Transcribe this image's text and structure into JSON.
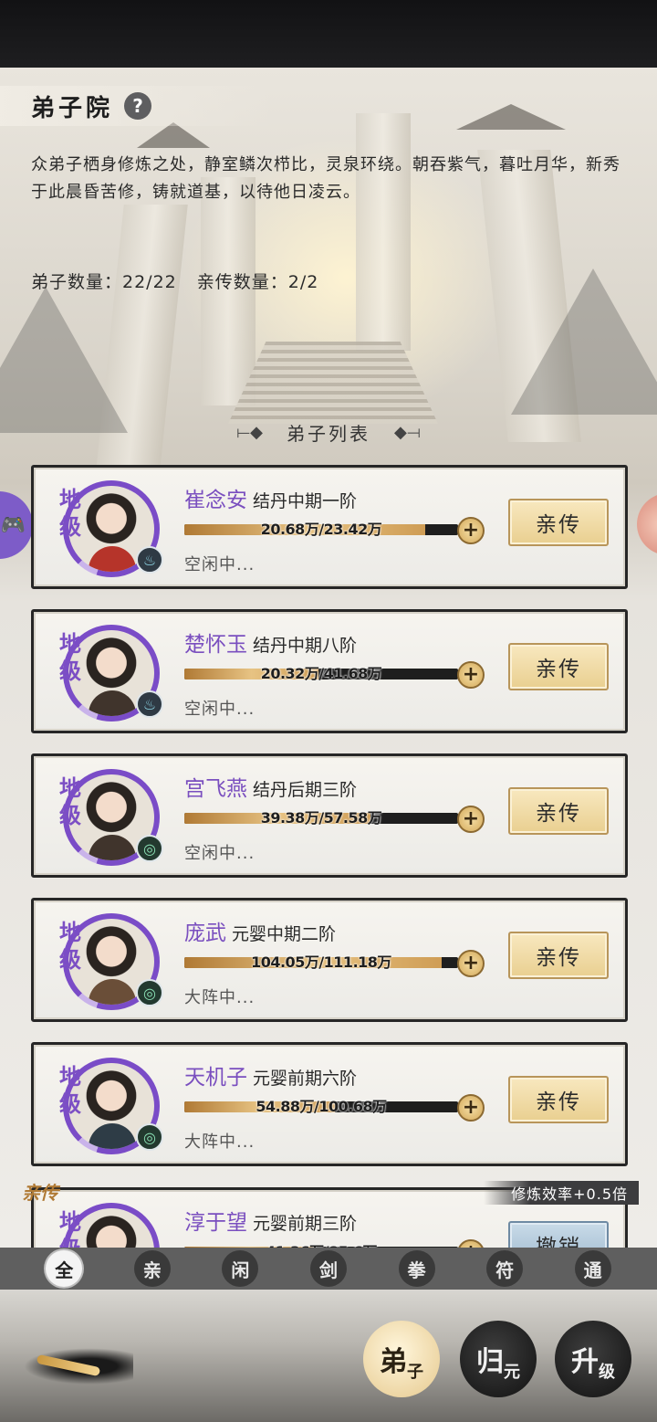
{
  "header": {
    "title": "弟子院",
    "help_icon": "?",
    "description": "众弟子栖身修炼之处，静室鳞次栉比，灵泉环绕。朝吞紫气，暮吐月华，新秀于此晨昏苦修，铸就道基，以待他日凌云。",
    "disciple_count": "弟子数量：22/22",
    "direct_count": "亲传数量：2/2"
  },
  "list_title": "弟子列表",
  "disciples": [
    {
      "grade": "地级",
      "name": "崔念安",
      "realm": "结丹中期一阶",
      "progress_text": "20.68万/23.42万",
      "progress": 0.88,
      "status": "空闲中...",
      "element_icon": "water-drop-icon",
      "action": "亲传"
    },
    {
      "grade": "地级",
      "name": "楚怀玉",
      "realm": "结丹中期八阶",
      "progress_text": "20.32万/41.68万",
      "progress": 0.49,
      "status": "空闲中...",
      "element_icon": "water-drop-icon",
      "action": "亲传"
    },
    {
      "grade": "地级",
      "name": "宫飞燕",
      "realm": "结丹后期三阶",
      "progress_text": "39.38万/57.58万",
      "progress": 0.68,
      "status": "空闲中...",
      "element_icon": "wind-swirl-icon",
      "action": "亲传"
    },
    {
      "grade": "地级",
      "name": "庞武",
      "realm": "元婴中期二阶",
      "progress_text": "104.05万/111.18万",
      "progress": 0.94,
      "status": "大阵中...",
      "element_icon": "wind-swirl-icon",
      "action": "亲传"
    },
    {
      "grade": "地级",
      "name": "天机子",
      "realm": "元婴前期六阶",
      "progress_text": "54.88万/100.68万",
      "progress": 0.55,
      "status": "大阵中...",
      "element_icon": "wind-swirl-icon",
      "action": "亲传"
    }
  ],
  "partial_disciple": {
    "tag": "亲传",
    "efficiency": "修炼效率+0.5倍",
    "grade": "地级",
    "name": "淳于望",
    "realm": "元婴前期三阶",
    "progress_text": "41.36万/85.6万",
    "progress": 0.48,
    "action": "撤销"
  },
  "filters": [
    "全",
    "亲",
    "闲",
    "剑",
    "拳",
    "符",
    "通"
  ],
  "filter_active_index": 0,
  "bottom_nav": {
    "disciple": {
      "big": "弟",
      "small": "子"
    },
    "return": {
      "big": "归",
      "small": "元"
    },
    "upgrade": {
      "big": "升",
      "small": "级"
    }
  },
  "colors": {
    "accent_purple": "#7a4fbf",
    "gold_button": "#e9cf90",
    "progress_gold": "#e7c383"
  }
}
